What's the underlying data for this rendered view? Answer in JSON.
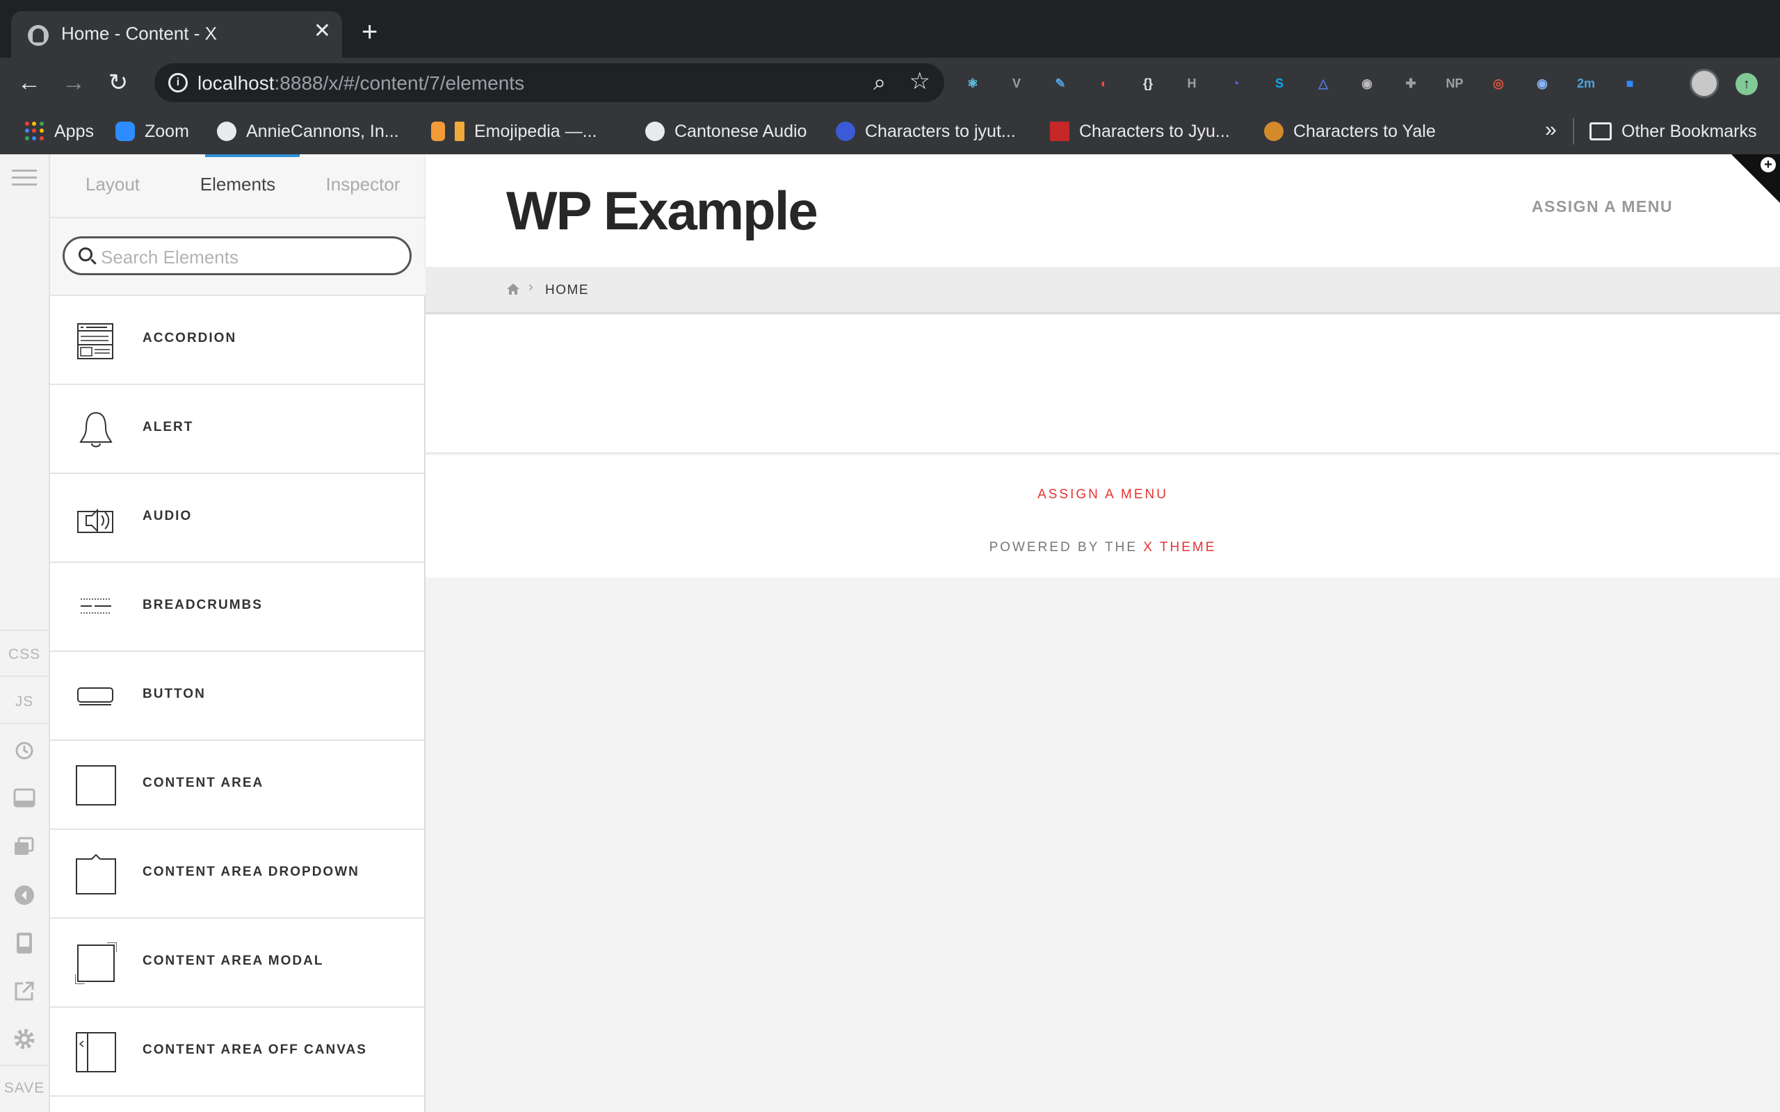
{
  "browser": {
    "tab_title": "Home - Content - X",
    "url_host": "localhost",
    "url_rest": ":8888/x/#/content/7/elements",
    "bookmarks": [
      {
        "label": "Apps",
        "icon": "apps-icon"
      },
      {
        "label": "Zoom",
        "icon": "zoom-icon"
      },
      {
        "label": "AnnieCannons, In...",
        "icon": "github-icon"
      },
      {
        "label": "Emojipedia —...",
        "icon": "bookmark-icon"
      },
      {
        "label": "Cantonese Audio",
        "icon": "globe-icon"
      },
      {
        "label": "Characters to jyut...",
        "icon": "site-icon"
      },
      {
        "label": "Characters to Jyu...",
        "icon": "site-icon"
      },
      {
        "label": "Characters to Yale",
        "icon": "site-icon"
      }
    ],
    "more_bookmarks": "»",
    "other_bookmarks": "Other Bookmarks",
    "extensions": [
      {
        "name": "react-devtools-icon",
        "glyph": "⚛",
        "color": "#61dafb"
      },
      {
        "name": "vue-icon",
        "glyph": "V",
        "color": "#9aa0a6"
      },
      {
        "name": "color-picker-icon",
        "glyph": "✎",
        "color": "#4fa3e0"
      },
      {
        "name": "colorzilla-icon",
        "glyph": "◐",
        "color": "#e84c3d"
      },
      {
        "name": "json-icon",
        "glyph": "{}",
        "color": "#e8eaed"
      },
      {
        "name": "headings-icon",
        "glyph": "H",
        "color": "#9aa0a6"
      },
      {
        "name": "clock-icon",
        "glyph": "◔",
        "color": "#5b6ee1"
      },
      {
        "name": "skype-icon",
        "glyph": "S",
        "color": "#00aff0"
      },
      {
        "name": "triangle-icon",
        "glyph": "△",
        "color": "#4a7ed8"
      },
      {
        "name": "lens-icon",
        "glyph": "◉",
        "color": "#bbbbbb"
      },
      {
        "name": "puzzle-icon",
        "glyph": "✚",
        "color": "#9aa0a6"
      },
      {
        "name": "np-icon",
        "glyph": "NP",
        "color": "#9aa0a6"
      },
      {
        "name": "swirl-icon",
        "glyph": "◎",
        "color": "#e2543f"
      },
      {
        "name": "eye-icon",
        "glyph": "◉",
        "color": "#8ab4f8"
      },
      {
        "name": "timer-icon",
        "glyph": "2m",
        "color": "#4fa3e0"
      },
      {
        "name": "zoom-ext-icon",
        "glyph": "■",
        "color": "#2d8cff"
      }
    ]
  },
  "builder": {
    "tabs": [
      "Layout",
      "Elements",
      "Inspector"
    ],
    "active_tab": "Elements",
    "search_placeholder": "Search Elements",
    "rail": {
      "css": "CSS",
      "js": "JS",
      "save": "SAVE"
    },
    "elements": [
      {
        "label": "ACCORDION",
        "icon": "accordion-icon"
      },
      {
        "label": "ALERT",
        "icon": "bell-icon"
      },
      {
        "label": "AUDIO",
        "icon": "speaker-icon"
      },
      {
        "label": "BREADCRUMBS",
        "icon": "breadcrumbs-icon"
      },
      {
        "label": "BUTTON",
        "icon": "button-icon"
      },
      {
        "label": "CONTENT AREA",
        "icon": "content-area-icon"
      },
      {
        "label": "CONTENT AREA DROPDOWN",
        "icon": "content-area-dropdown-icon"
      },
      {
        "label": "CONTENT AREA MODAL",
        "icon": "content-area-modal-icon"
      },
      {
        "label": "CONTENT AREA OFF CANVAS",
        "icon": "content-area-off-canvas-icon"
      }
    ]
  },
  "site": {
    "title": "WP Example",
    "header_menu": "ASSIGN A MENU",
    "breadcrumb_current": "HOME",
    "footer_menu": "ASSIGN A MENU",
    "powered_prefix": "POWERED BY THE",
    "powered_link": "X THEME",
    "accent_color": "#e63333"
  }
}
